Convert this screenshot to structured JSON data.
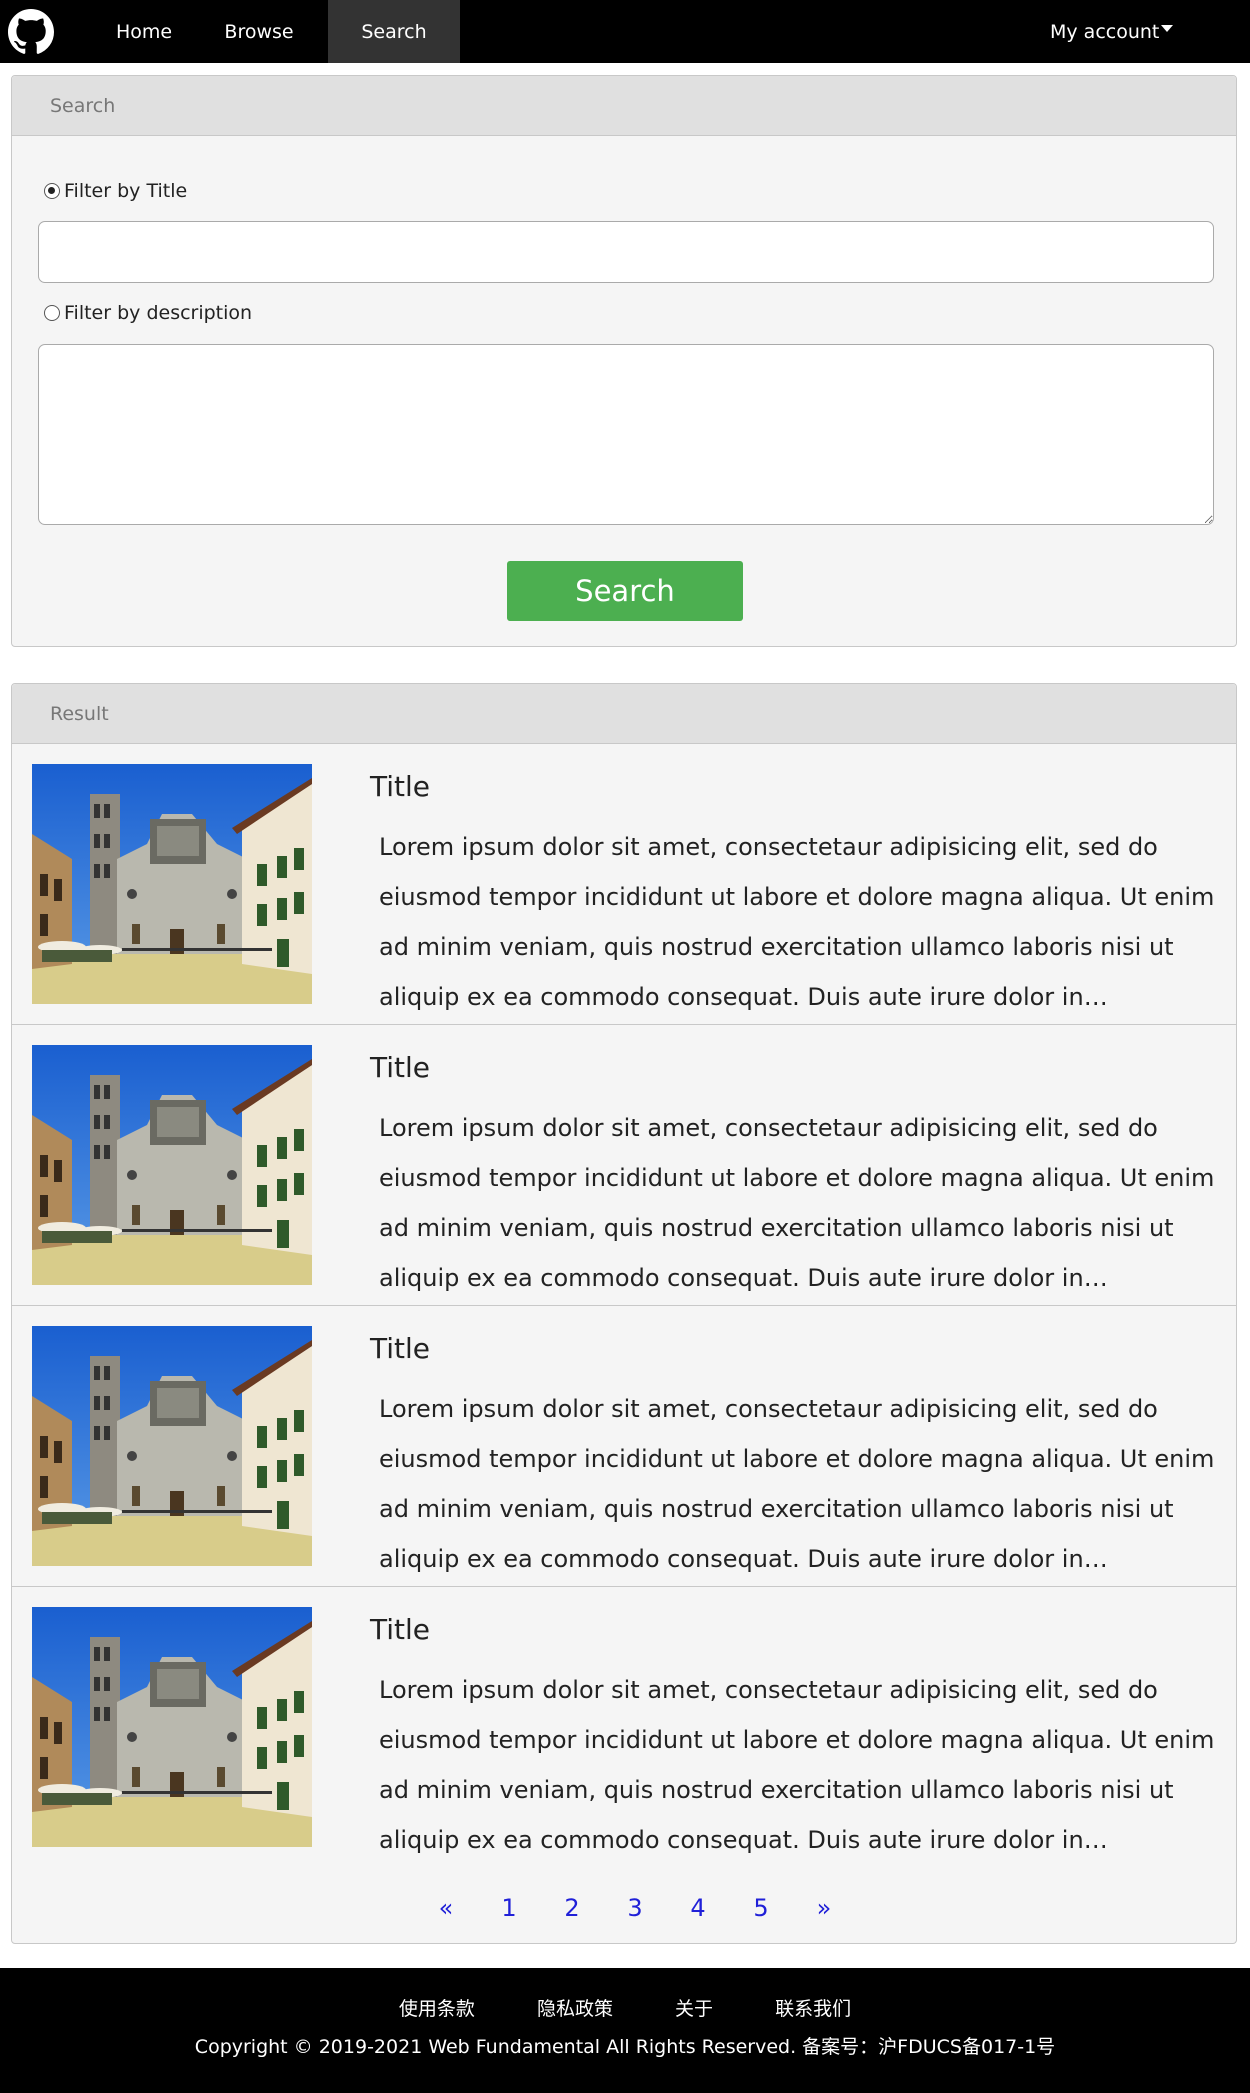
{
  "nav": {
    "logo_icon": "github-octocat-icon",
    "items": [
      {
        "label": "Home"
      },
      {
        "label": "Browse"
      },
      {
        "label": "Search",
        "active": true
      }
    ],
    "account_label": "My account"
  },
  "search_panel": {
    "heading": "Search",
    "filter_title_label": "Filter by Title",
    "filter_title_selected": true,
    "title_value": "",
    "filter_desc_label": "Filter by description",
    "filter_desc_selected": false,
    "desc_value": "",
    "button_label": "Search",
    "button_color": "#4caf50"
  },
  "result_panel": {
    "heading": "Result",
    "items": [
      {
        "title": "Title",
        "description": "Lorem ipsum dolor sit amet, consectetaur adipisicing elit, sed do eiusmod tempor incididunt ut labore et dolore magna aliqua. Ut enim ad minim veniam, quis nostrud exercitation ullamco laboris nisi ut aliquip ex ea commodo consequat. Duis aute irure dolor in reprehenderit in voluptate velit esse cillum dolore eu fugiat nulla pariatur."
      },
      {
        "title": "Title",
        "description": "Lorem ipsum dolor sit amet, consectetaur adipisicing elit, sed do eiusmod tempor incididunt ut labore et dolore magna aliqua. Ut enim ad minim veniam, quis nostrud exercitation ullamco laboris nisi ut aliquip ex ea commodo consequat. Duis aute irure dolor in reprehenderit in voluptate velit esse cillum dolore eu fugiat nulla pariatur."
      },
      {
        "title": "Title",
        "description": "Lorem ipsum dolor sit amet, consectetaur adipisicing elit, sed do eiusmod tempor incididunt ut labore et dolore magna aliqua. Ut enim ad minim veniam, quis nostrud exercitation ullamco laboris nisi ut aliquip ex ea commodo consequat. Duis aute irure dolor in reprehenderit in voluptate velit esse cillum dolore eu fugiat nulla pariatur."
      },
      {
        "title": "Title",
        "description": "Lorem ipsum dolor sit amet, consectetaur adipisicing elit, sed do eiusmod tempor incididunt ut labore et dolore magna aliqua. Ut enim ad minim veniam, quis nostrud exercitation ullamco laboris nisi ut aliquip ex ea commodo consequat. Duis aute irure dolor in reprehenderit in voluptate velit esse cillum dolore eu fugiat nulla pariatur."
      }
    ],
    "pagination": {
      "prev": "«",
      "pages": [
        "1",
        "2",
        "3",
        "4",
        "5"
      ],
      "next": "»",
      "link_color": "#2020d8"
    }
  },
  "footer": {
    "links": [
      "使用条款",
      "隐私政策",
      "关于",
      "联系我们"
    ],
    "copyright": "Copyright © 2019-2021 Web Fundamental All Rights Reserved. 备案号：沪FDUCS备017-1号"
  }
}
